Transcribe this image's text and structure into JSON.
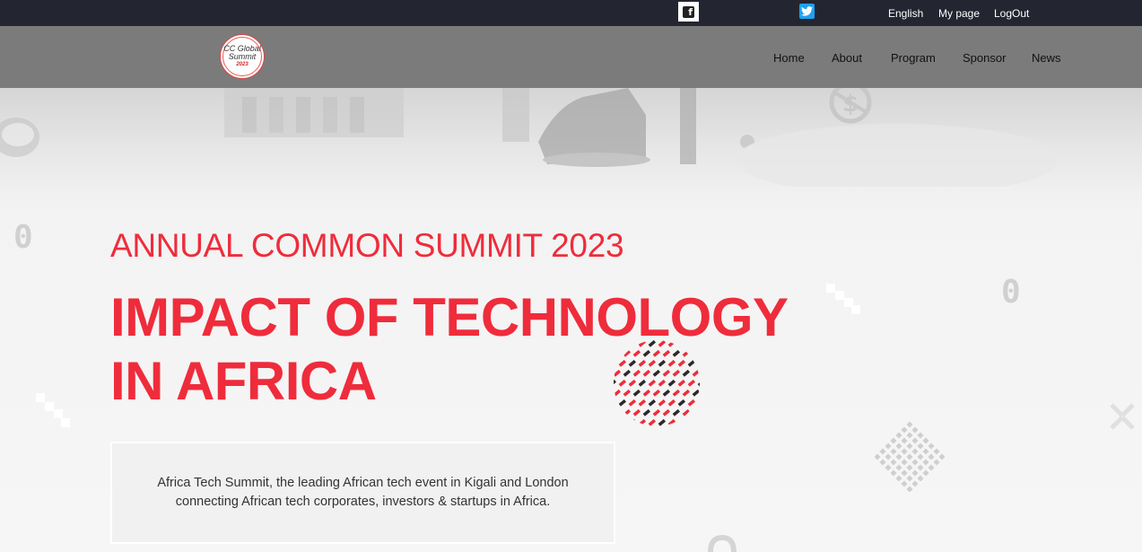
{
  "topbar": {
    "icons": [
      "facebook-icon",
      "twitter-icon"
    ],
    "links": [
      "English",
      "My page",
      "LogOut"
    ]
  },
  "logo": {
    "line1": "CC Global",
    "line2": "Summit",
    "year": "2023"
  },
  "nav": {
    "items": [
      "Home",
      "About",
      "Program",
      "Sponsor",
      "News"
    ]
  },
  "hero": {
    "subtitle": "ANNUAL COMMON SUMMIT 2023",
    "title": "IMPACT OF TECHNOLOGY IN AFRICA",
    "description": "Africa Tech Summit, the leading African tech event in Kigali and London connecting African tech corporates, investors & startups in Africa.",
    "decor_zero": "0"
  },
  "colors": {
    "accent": "#ef2c3b",
    "topbar": "#232530",
    "navbar": "#7b7b7b",
    "twitter": "#1da1f2"
  }
}
